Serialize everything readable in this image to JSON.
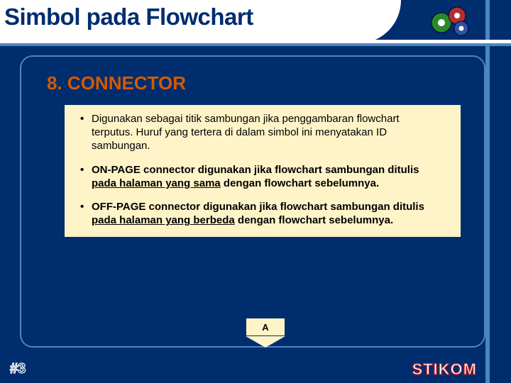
{
  "header": {
    "title": "Simbol pada Flowchart"
  },
  "section": {
    "number": "8.",
    "name": "CONNECTOR",
    "bullets": [
      {
        "text": "Digunakan sebagai titik sambungan jika penggambaran flowchart terputus. Huruf yang tertera di dalam simbol ini menyatakan ID sambungan.",
        "lead_normal": true
      },
      {
        "text": "ON-PAGE connector digunakan jika flowchart sambungan ditulis ",
        "u": "pada halaman yang sama",
        "tail": " dengan flowchart sebelumnya."
      },
      {
        "text": "OFF-PAGE connector digunakan jika flowchart sambungan ditulis ",
        "u": "pada halaman yang berbeda",
        "tail": " dengan flowchart sebelumnya."
      }
    ],
    "connector_label": "A"
  },
  "footer": {
    "slide": "#3",
    "brand": "STIKOM"
  },
  "icons": {
    "gears": "gears-icon"
  }
}
